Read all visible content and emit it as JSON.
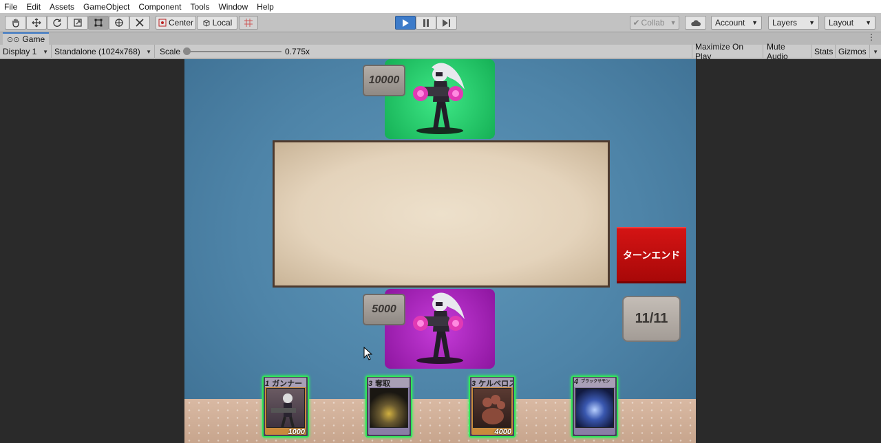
{
  "menu": [
    "File",
    "Edit",
    "Assets",
    "GameObject",
    "Component",
    "Tools",
    "Window",
    "Help"
  ],
  "toolbar": {
    "center_label": "Center",
    "local_label": "Local",
    "collab_label": "Collab",
    "account_label": "Account",
    "layers_label": "Layers",
    "layout_label": "Layout"
  },
  "tab": {
    "title": "Game"
  },
  "view": {
    "display": "Display 1",
    "resolution": "Standalone (1024x768)",
    "scale_label": "Scale",
    "scale_value": "0.775x",
    "maximize": "Maximize On Play",
    "mute": "Mute Audio",
    "stats": "Stats",
    "gizmos": "Gizmos"
  },
  "game": {
    "enemy_hp": "10000",
    "player_hp": "5000",
    "turn_end_label": "ターンエンド",
    "mana": "11/11",
    "colors": {
      "enemy_panel": "#2bd06b",
      "player_panel": "#b02ac4",
      "turn_end": "#c41010"
    },
    "hand": [
      {
        "cost": "1",
        "name": "ガンナー",
        "power": "1000",
        "frame": "orange"
      },
      {
        "cost": "3",
        "name": "奪取",
        "power": "",
        "frame": "purple"
      },
      {
        "cost": "3",
        "name": "ケルベロス",
        "power": "4000",
        "frame": "orange"
      },
      {
        "cost": "4",
        "name": "ブラックサモン",
        "power": "",
        "frame": "purple"
      }
    ]
  }
}
